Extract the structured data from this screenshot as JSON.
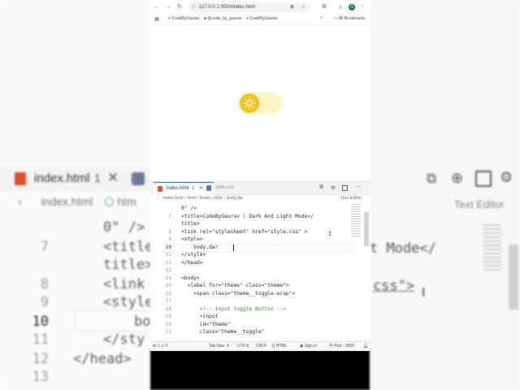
{
  "browser": {
    "url": "127.0.0.1:3000/index.html",
    "bookmarks": [
      {
        "label": "CodeByGaurav",
        "icon": "globe-icon"
      },
      {
        "label": "@code_by_gaurav",
        "icon": "instagram-icon"
      },
      {
        "label": "CodeByGaurav",
        "icon": "facebook-icon"
      }
    ],
    "all_bookmarks": "All Bookmarks",
    "more": "»",
    "avatar_letter": "G",
    "toggle_state": "light"
  },
  "editor": {
    "tabs": [
      {
        "label": "index.html",
        "badge": "1",
        "active": true
      },
      {
        "label": "style.css",
        "active": false
      }
    ],
    "breadcrumb": [
      "index.html",
      "html",
      "head",
      "style",
      "body.da"
    ],
    "text_editor_label": "Text Editor",
    "lines": [
      {
        "num": "",
        "text": "0\" />"
      },
      {
        "num": "7",
        "text": "<title>CodeByGaurav | Dark And Light Mode</"
      },
      {
        "num": "",
        "text": "title>"
      },
      {
        "num": "8",
        "text": "<link rel=\"stylesheet\" href=\"style.css\" >"
      },
      {
        "num": "9",
        "text": "<style>"
      },
      {
        "num": "10",
        "text": "    body.dar"
      },
      {
        "num": "11",
        "text": "</style>"
      },
      {
        "num": "12",
        "text": "</head>"
      },
      {
        "num": "13",
        "text": ""
      },
      {
        "num": "14",
        "text": "<body>"
      },
      {
        "num": "15",
        "text": "  <label for=\"theme\" class=\"theme\">"
      },
      {
        "num": "16",
        "text": "    <span class=\"theme__toggle-wrap\">"
      },
      {
        "num": "17",
        "text": ""
      },
      {
        "num": "18",
        "text": "      <!-- Input toggle Button -->"
      },
      {
        "num": "19",
        "text": "      <input"
      },
      {
        "num": "20",
        "text": "      id=\"theme\""
      },
      {
        "num": "21",
        "text": "      class=\"theme__toggle\""
      }
    ],
    "current_line": "10",
    "status": {
      "errors": "1",
      "warnings": "0",
      "tab_size": "Tab Size: 4",
      "encoding": "UTF-8",
      "eol": "CRLF",
      "language": "HTML",
      "sign_in": "Sign in",
      "port": "Port : 3000"
    }
  },
  "background": {
    "tab_label": "index.html",
    "tab_badge": "1",
    "breadcrumb": "index.html",
    "breadcrumb_next": "htm",
    "text_editor": "Text Editor",
    "lines": [
      {
        "num": "",
        "text": "0\" />"
      },
      {
        "num": "7",
        "text": "<title"
      },
      {
        "num": "",
        "text": "title>"
      },
      {
        "num": "8",
        "text": "<link"
      },
      {
        "num": "9",
        "text": "<style"
      },
      {
        "num": "10",
        "text": "bo"
      },
      {
        "num": "11",
        "text": "</sty"
      },
      {
        "num": "12",
        "text": "</head>"
      },
      {
        "num": "13",
        "text": ""
      }
    ],
    "right_fragments": [
      "t Mode</",
      "css\">"
    ]
  }
}
